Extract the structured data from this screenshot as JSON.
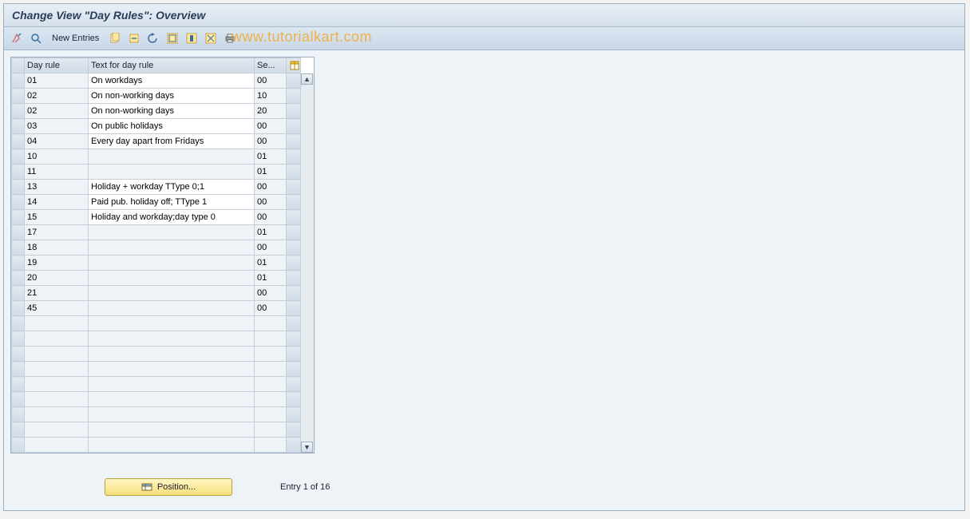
{
  "header": {
    "title": "Change View \"Day Rules\": Overview"
  },
  "toolbar": {
    "new_entries_label": "New Entries"
  },
  "watermark": "www.tutorialkart.com",
  "table": {
    "columns": {
      "rule": "Day rule",
      "text": "Text for day rule",
      "se": "Se..."
    },
    "total_visible_rows": 25,
    "rows": [
      {
        "rule": "01",
        "text": "On workdays",
        "se": "00",
        "highlight": true
      },
      {
        "rule": "02",
        "text": "On non-working days",
        "se": "10"
      },
      {
        "rule": "02",
        "text": "On non-working days",
        "se": "20"
      },
      {
        "rule": "03",
        "text": "On public holidays",
        "se": "00"
      },
      {
        "rule": "04",
        "text": "Every day apart from Fridays",
        "se": "00"
      },
      {
        "rule": "10",
        "text": "",
        "se": "01"
      },
      {
        "rule": "11",
        "text": "",
        "se": "01"
      },
      {
        "rule": "13",
        "text": "Holiday + workday TType 0;1",
        "se": "00"
      },
      {
        "rule": "14",
        "text": "Paid pub. holiday off; TType 1",
        "se": "00"
      },
      {
        "rule": "15",
        "text": "Holiday and workday;day type 0",
        "se": "00"
      },
      {
        "rule": "17",
        "text": "",
        "se": "01"
      },
      {
        "rule": "18",
        "text": "",
        "se": "00"
      },
      {
        "rule": "19",
        "text": "",
        "se": "01"
      },
      {
        "rule": "20",
        "text": "",
        "se": "01"
      },
      {
        "rule": "21",
        "text": "",
        "se": "00"
      },
      {
        "rule": "45",
        "text": "",
        "se": "00"
      }
    ]
  },
  "footer": {
    "position_label": "Position...",
    "entry_text": "Entry 1 of 16"
  }
}
